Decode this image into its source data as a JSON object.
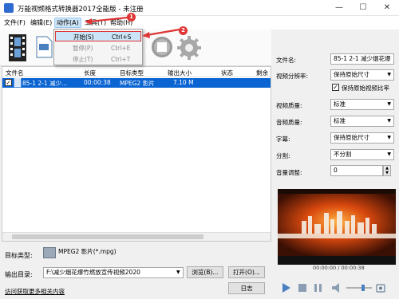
{
  "window": {
    "title": "万能视频格式转换器2017全能版 - 未注册",
    "minimize": "—",
    "maximize": "☐",
    "close": "✕"
  },
  "menu": {
    "file": "文件(F)",
    "edit": "编辑(E)",
    "action": "动作(A)",
    "tools": "工具(T)",
    "help": "帮助(H)"
  },
  "callouts": {
    "one": "1",
    "two": "2"
  },
  "dropdown": {
    "items": [
      {
        "label": "开始(S)",
        "shortcut": "Ctrl+S"
      },
      {
        "label": "暂停(P)",
        "shortcut": "Ctrl+E"
      },
      {
        "label": "停止(T)",
        "shortcut": "Ctrl+T"
      }
    ]
  },
  "list": {
    "headers": [
      "文件名",
      "长度",
      "目标类型",
      "输出大小",
      "状态",
      "剩余"
    ],
    "rows": [
      {
        "check": "✓",
        "name": "85-1  2-1 减少...",
        "length": "00:00:38",
        "type": "MPEG2 影片",
        "size": "7.10 M"
      }
    ]
  },
  "bottom": {
    "target_label": "目标类型:",
    "target_value": "MPEG2 影片(*.mpg)",
    "output_label": "输出目录:",
    "output_value": "F:\\减少烟花爆竹燃放宣传视频2020",
    "browse": "浏览(B)...",
    "open": "打开(O)...",
    "log": "日志",
    "link": "访问获取更多相关内容"
  },
  "props": {
    "filename_label": "文件名:",
    "filename_value": "85-1  2-1 减少烟花爆",
    "resolution_label": "视频分辨率:",
    "resolution_value": "保持原始尺寸",
    "keep_ratio_label": "保持原始视频比率",
    "keep_ratio_checked": "✓",
    "vquality_label": "视频质量:",
    "vquality_value": "标准",
    "aquality_label": "音频质量:",
    "aquality_value": "标准",
    "subtitle_label": "字幕:",
    "subtitle_value": "保持原始尺寸",
    "split_label": "分割:",
    "split_value": "不分割",
    "volume_label": "音量调整:",
    "volume_value": "0"
  },
  "player": {
    "time": "00:00:00 / 00:00:38"
  },
  "colors": {
    "accent": "#0a64d2",
    "highlight": "#e03535"
  }
}
